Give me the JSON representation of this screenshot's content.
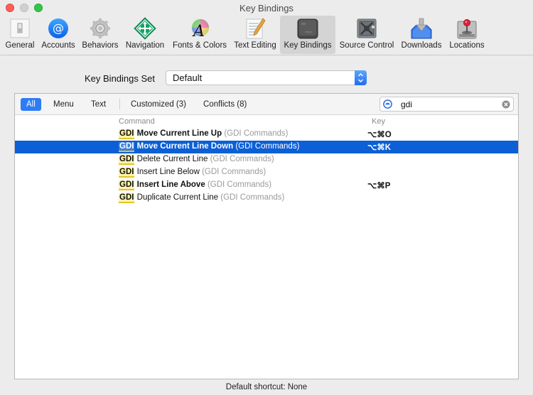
{
  "window": {
    "title": "Key Bindings"
  },
  "toolbar": {
    "items": [
      {
        "label": "General",
        "icon": "general-switch-icon"
      },
      {
        "label": "Accounts",
        "icon": "at-sign-icon"
      },
      {
        "label": "Behaviors",
        "icon": "gear-icon"
      },
      {
        "label": "Navigation",
        "icon": "navigation-arrows-icon"
      },
      {
        "label": "Fonts & Colors",
        "icon": "fonts-colors-icon"
      },
      {
        "label": "Text Editing",
        "icon": "text-editing-icon"
      },
      {
        "label": "Key Bindings",
        "icon": "keyboard-key-icon",
        "selected": true
      },
      {
        "label": "Source Control",
        "icon": "vault-icon"
      },
      {
        "label": "Downloads",
        "icon": "download-tray-icon"
      },
      {
        "label": "Locations",
        "icon": "hard-drive-joystick-icon"
      }
    ]
  },
  "key_bindings_set": {
    "label": "Key Bindings Set",
    "value": "Default"
  },
  "filters": {
    "all": "All",
    "menu": "Menu",
    "text": "Text",
    "customized": "Customized (3)",
    "conflicts": "Conflicts (8)",
    "active": "All"
  },
  "search": {
    "value": "gdi"
  },
  "table": {
    "columns": {
      "command": "Command",
      "key": "Key"
    },
    "rows": [
      {
        "prefix": "GDI",
        "name": "Move Current Line Up",
        "group": "(GDI Commands)",
        "key": "⌥⌘O",
        "bold": true,
        "selected": false
      },
      {
        "prefix": "GDI",
        "name": "Move Current Line Down",
        "group": "(GDI Commands)",
        "key": "⌥⌘K",
        "bold": true,
        "selected": true
      },
      {
        "prefix": "GDI",
        "name": "Delete Current Line",
        "group": "(GDI Commands)",
        "key": "",
        "bold": false,
        "selected": false
      },
      {
        "prefix": "GDI",
        "name": "Insert Line Below",
        "group": "(GDI Commands)",
        "key": "",
        "bold": false,
        "selected": false
      },
      {
        "prefix": "GDI",
        "name": "Insert Line Above",
        "group": "(GDI Commands)",
        "key": "⌥⌘P",
        "bold": true,
        "selected": false
      },
      {
        "prefix": "GDI",
        "name": "Duplicate Current Line",
        "group": "(GDI Commands)",
        "key": "",
        "bold": false,
        "selected": false
      }
    ]
  },
  "footer": {
    "text": "Default shortcut: None"
  },
  "colors": {
    "accent": "#2d7cf6",
    "selection": "#0c5fd4",
    "match_highlight": "#fff4a6"
  }
}
